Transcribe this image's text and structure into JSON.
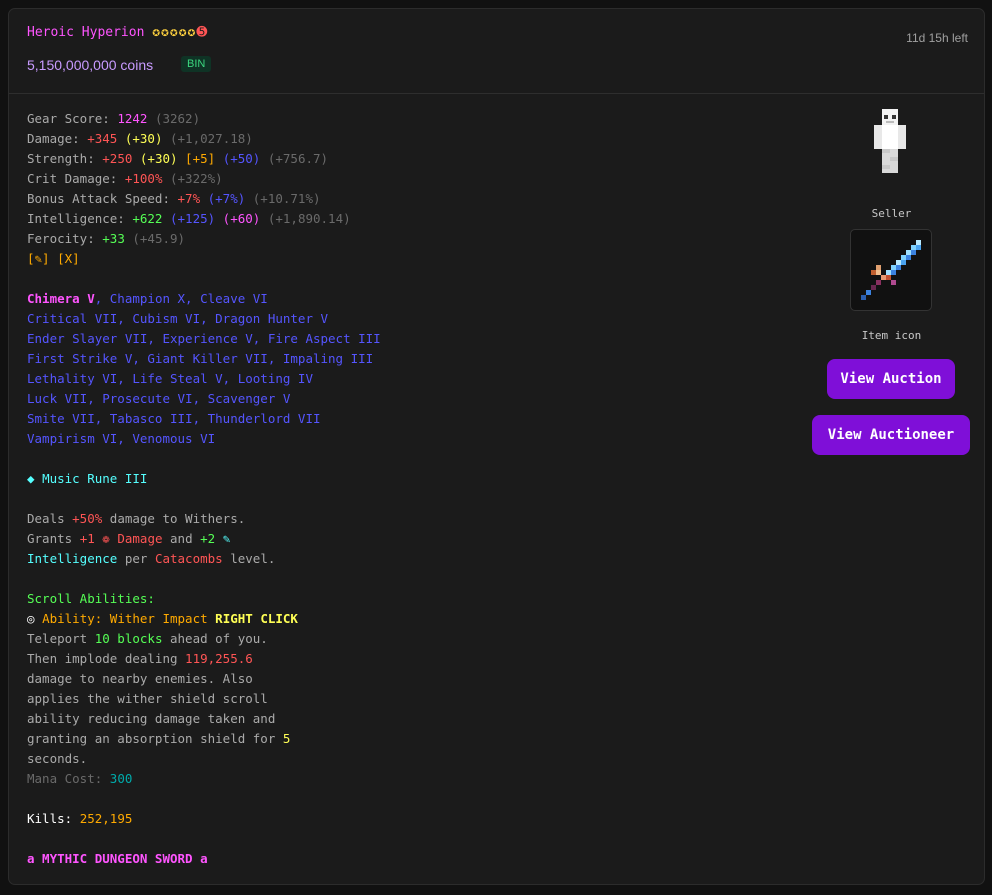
{
  "header": {
    "item_name": "Heroic Hyperion",
    "stars": "✪✪✪✪✪",
    "master_star": "➎",
    "price": "5,150,000,000 coins",
    "badge": "BIN",
    "time_left": "11d 15h left"
  },
  "lore": {
    "gear_score": {
      "label": "Gear Score: ",
      "value": "1242",
      "extra": " (3262)"
    },
    "damage": {
      "label": "Damage: ",
      "value": "+345",
      "hpb": " (+30)",
      "extra": " (+1,027.18)"
    },
    "strength": {
      "label": "Strength: ",
      "value": "+250",
      "hpb": " (+30)",
      "reforge": " [+5]",
      "gem": " (+50)",
      "extra": " (+756.7)"
    },
    "crit_damage": {
      "label": "Crit Damage: ",
      "value": "+100%",
      "extra": " (+322%)"
    },
    "attack_speed": {
      "label": "Bonus Attack Speed: ",
      "value": "+7%",
      "gem": " (+7%)",
      "extra": " (+10.71%)"
    },
    "intelligence": {
      "label": "Intelligence: ",
      "value": "+622",
      "gem": " (+125)",
      "reforge": " (+60)",
      "extra": " (+1,890.14)"
    },
    "ferocity": {
      "label": "Ferocity: ",
      "value": "+33",
      "extra": " (+45.9)"
    },
    "gem_slots": {
      "slot1": "[✎]",
      "slot2": "[X]"
    },
    "enchants": {
      "ultimate": "Chimera V",
      "line1_rest": ", Champion X, Cleave VI",
      "line2": "Critical VII, Cubism VI, Dragon Hunter V",
      "line3": "Ender Slayer VII, Experience V, Fire Aspect III",
      "line4": "First Strike V, Giant Killer VII, Impaling III",
      "line5": "Lethality VI, Life Steal V, Looting IV",
      "line6": "Luck VII, Prosecute VI, Scavenger V",
      "line7": "Smite VII, Tabasco III, Thunderlord VII",
      "line8": "Vampirism VI, Venomous VI"
    },
    "rune": {
      "bullet": "◆",
      "name": "Music Rune III"
    },
    "deals": {
      "pre": "Deals ",
      "value": "+50%",
      "post": " damage to Withers."
    },
    "grants": {
      "pre": "Grants ",
      "dmg_value": "+1",
      "dmg_icon": "❁",
      "dmg_label": "Damage",
      "and": " and ",
      "int_value": "+2",
      "int_icon": "✎",
      "int_label": "Intelligence",
      "per": " per ",
      "catacombs": "Catacombs",
      "level": " level."
    },
    "scroll_title": "Scroll Abilities:",
    "ability": {
      "icon": "◎",
      "label": "Ability: Wither Impact",
      "click": "RIGHT CLICK"
    },
    "ability_desc": {
      "l1_pre": "Teleport ",
      "l1_blocks": "10 blocks",
      "l1_post": " ahead of you.",
      "l2_pre": "Then implode dealing ",
      "l2_dmg": "119,255.6",
      "l3": "damage to nearby enemies. Also",
      "l4": "applies the wither shield scroll",
      "l5": "ability reducing damage taken and",
      "l6_pre": "granting an absorption shield for ",
      "l6_num": "5",
      "l7": "seconds."
    },
    "mana": {
      "label": "Mana Cost: ",
      "value": "300"
    },
    "kills": {
      "label": "Kills: ",
      "value": "252,195"
    },
    "rarity": "a MYTHIC DUNGEON SWORD a"
  },
  "side": {
    "seller_label": "Seller",
    "item_icon_label": "Item icon",
    "view_auction": "View Auction",
    "view_auctioneer": "View Auctioneer"
  }
}
